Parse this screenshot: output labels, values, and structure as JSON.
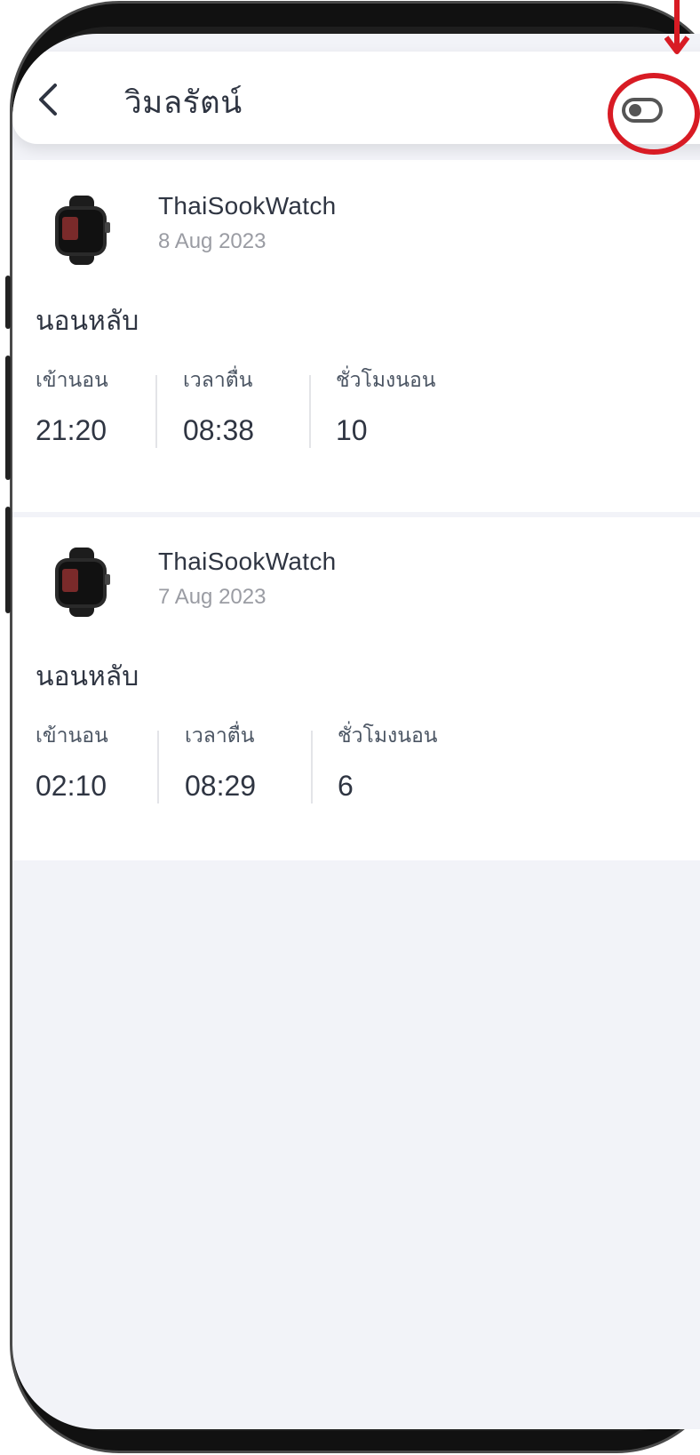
{
  "header": {
    "title": "วิมลรัตน์",
    "back_icon": "chevron-left-icon",
    "toggle_icon": "toggle-icon",
    "toggle_state": "off"
  },
  "records": [
    {
      "device_name": "ThaiSookWatch",
      "date": "8 Aug 2023",
      "section_title": "นอนหลับ",
      "stats": [
        {
          "label": "เข้านอน",
          "value": "21:20"
        },
        {
          "label": "เวลาตื่น",
          "value": "08:38"
        },
        {
          "label": "ชั่วโมงนอน",
          "value": "10"
        }
      ]
    },
    {
      "device_name": "ThaiSookWatch",
      "date": "7 Aug 2023",
      "section_title": "นอนหลับ",
      "stats": [
        {
          "label": "เข้านอน",
          "value": "02:10"
        },
        {
          "label": "เวลาตื่น",
          "value": "08:29"
        },
        {
          "label": "ชั่วโมงนอน",
          "value": "6"
        }
      ]
    }
  ],
  "colors": {
    "highlight": "#d81b24",
    "text_primary": "#2f3542",
    "text_secondary": "#9a9ca3",
    "background": "#f2f3f8"
  }
}
